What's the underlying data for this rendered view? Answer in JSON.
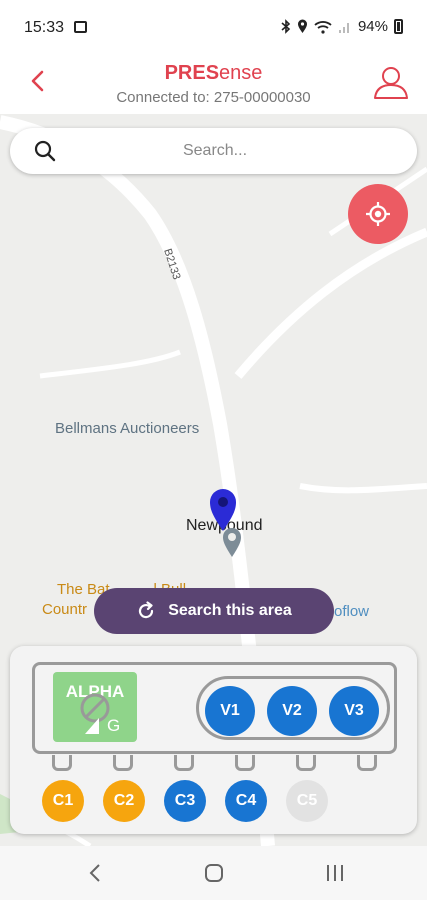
{
  "status_bar": {
    "time": "15:33",
    "battery": "94%"
  },
  "header": {
    "brand_bold": "PRES",
    "brand_light": "ense",
    "connection": "Connected to: 275-00000030"
  },
  "search": {
    "placeholder": "Search..."
  },
  "map": {
    "labels": {
      "road": "B2133",
      "poi": "Bellmans Auctioneers",
      "town": "Newpound",
      "poi2_line1": "The Bat",
      "poi2_line1_end": "l Bull",
      "poi2_line2": "Countr",
      "poi3": "oflow"
    }
  },
  "search_area_button": {
    "label": "Search this area"
  },
  "device": {
    "name": "ALPHA",
    "network": "G",
    "voltage_channels": [
      "V1",
      "V2",
      "V3"
    ],
    "current_channels": [
      {
        "label": "C1",
        "state": "orange"
      },
      {
        "label": "C2",
        "state": "orange"
      },
      {
        "label": "C3",
        "state": "blue"
      },
      {
        "label": "C4",
        "state": "blue"
      },
      {
        "label": "C5",
        "state": "grey"
      }
    ]
  },
  "colors": {
    "brand": "#e0424f",
    "locate": "#ec5b63",
    "search_area": "#5a4472",
    "blue": "#1875d2",
    "orange": "#f6a50e",
    "alpha": "#8fd48a"
  },
  "icons": [
    "back-chevron-icon",
    "user-icon",
    "search-icon",
    "locate-icon",
    "refresh-icon",
    "map-pin-icon",
    "no-signal-icon"
  ]
}
